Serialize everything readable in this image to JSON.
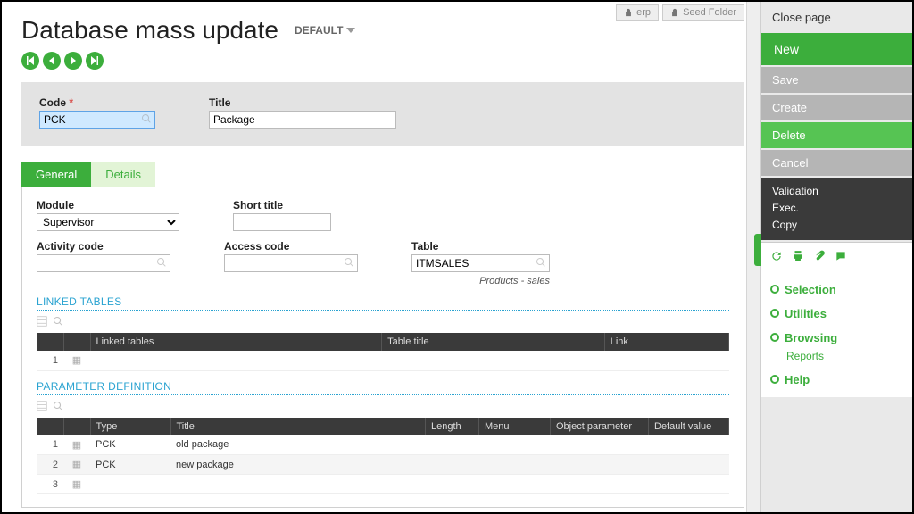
{
  "toplinks": {
    "erp": "erp",
    "seed": "Seed Folder"
  },
  "page": {
    "title": "Database mass update",
    "variant": "DEFAULT"
  },
  "header": {
    "code_label": "Code",
    "code_value": "PCK",
    "title_label": "Title",
    "title_value": "Package"
  },
  "tabs": {
    "general": "General",
    "details": "Details"
  },
  "general": {
    "module_label": "Module",
    "module_value": "Supervisor",
    "shorttitle_label": "Short title",
    "shorttitle_value": "",
    "activity_label": "Activity code",
    "activity_value": "",
    "access_label": "Access code",
    "access_value": "",
    "table_label": "Table",
    "table_value": "ITMSALES",
    "table_hint": "Products - sales"
  },
  "linked": {
    "section": "LINKED TABLES",
    "cols": {
      "lt": "Linked tables",
      "tt": "Table title",
      "lk": "Link"
    },
    "rows": [
      {
        "n": "1",
        "lt": "",
        "tt": "",
        "lk": ""
      }
    ]
  },
  "paramdef": {
    "section": "PARAMETER DEFINITION",
    "cols": {
      "type": "Type",
      "title": "Title",
      "length": "Length",
      "menu": "Menu",
      "objp": "Object parameter",
      "defv": "Default value"
    },
    "rows": [
      {
        "n": "1",
        "type": "PCK",
        "title": "old package",
        "length": "",
        "menu": "",
        "objp": "",
        "defv": ""
      },
      {
        "n": "2",
        "type": "PCK",
        "title": "new package",
        "length": "",
        "menu": "",
        "objp": "",
        "defv": ""
      },
      {
        "n": "3",
        "type": "",
        "title": "",
        "length": "",
        "menu": "",
        "objp": "",
        "defv": ""
      }
    ]
  },
  "sidebar": {
    "close": "Close page",
    "new": "New",
    "save": "Save",
    "create": "Create",
    "delete": "Delete",
    "cancel": "Cancel",
    "validation": "Validation",
    "exec": "Exec.",
    "copy": "Copy",
    "links": {
      "selection": "Selection",
      "utilities": "Utilities",
      "browsing": "Browsing",
      "reports": "Reports",
      "help": "Help"
    }
  }
}
